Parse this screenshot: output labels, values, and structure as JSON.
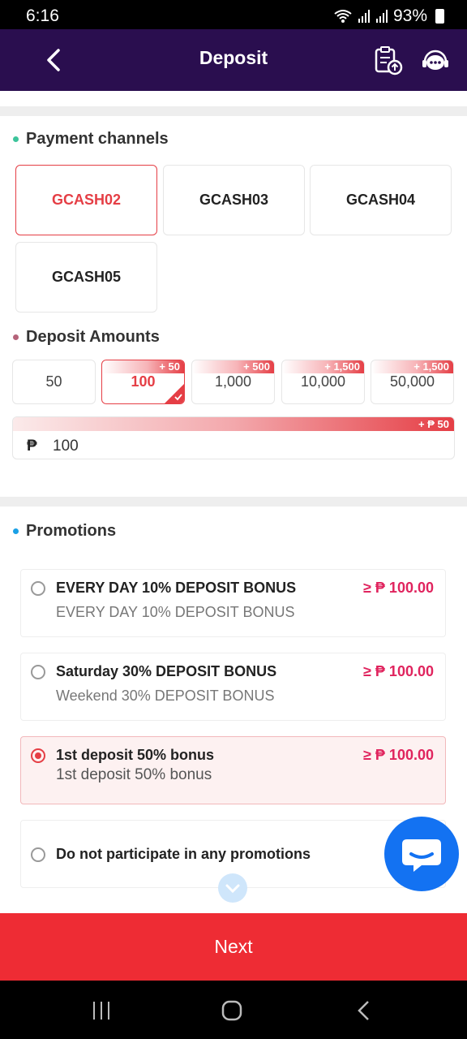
{
  "status_bar": {
    "time": "6:16",
    "battery": "93%"
  },
  "header": {
    "title": "Deposit"
  },
  "payment_channels": {
    "title": "Payment channels",
    "items": [
      {
        "label": "GCASH02",
        "selected": true
      },
      {
        "label": "GCASH03",
        "selected": false
      },
      {
        "label": "GCASH04",
        "selected": false
      },
      {
        "label": "GCASH05",
        "selected": false
      }
    ]
  },
  "deposit_amounts": {
    "title": "Deposit Amounts",
    "items": [
      {
        "label": "50",
        "bonus": ""
      },
      {
        "label": "100",
        "bonus": "+ 50",
        "selected": true
      },
      {
        "label": "1,000",
        "bonus": "+ 500"
      },
      {
        "label": "10,000",
        "bonus": "+ 1,500"
      },
      {
        "label": "50,000",
        "bonus": "+ 1,500"
      }
    ],
    "field": {
      "currency": "₱",
      "value": "100",
      "bonus": "+ ₱ 50"
    }
  },
  "promotions": {
    "title": "Promotions",
    "items": [
      {
        "title": "EVERY DAY 10% DEPOSIT BONUS",
        "subtitle": "EVERY DAY 10% DEPOSIT BONUS",
        "min": "≥ ₱ 100.00",
        "selected": false
      },
      {
        "title": "Saturday 30% DEPOSIT BONUS",
        "subtitle": "Weekend 30% DEPOSIT BONUS",
        "min": "≥ ₱ 100.00",
        "selected": false
      },
      {
        "title": "1st deposit 50% bonus",
        "subtitle": "1st deposit 50% bonus",
        "min": "≥ ₱ 100.00",
        "selected": true
      },
      {
        "title": "Do not participate in any promotions",
        "selected": false
      }
    ]
  },
  "next_button": {
    "label": "Next"
  },
  "colors": {
    "header_bg": "#2a0e4f",
    "accent": "#e53e45",
    "next_bg": "#ee2c34",
    "promo_min": "#e0245e",
    "chat": "#1372f2"
  }
}
